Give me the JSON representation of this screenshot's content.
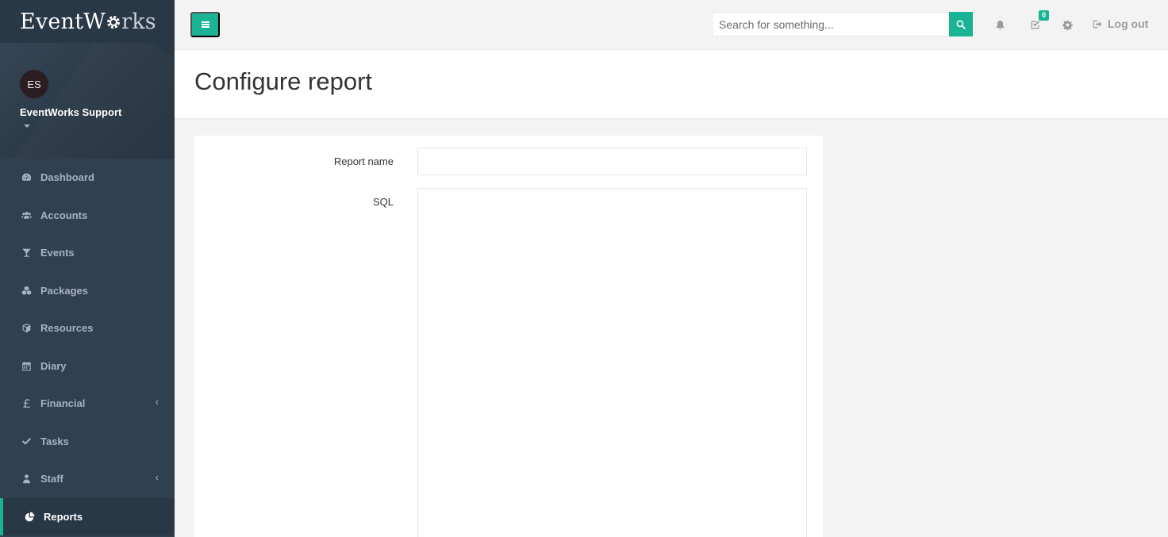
{
  "app": {
    "logo_part1": "EventW",
    "logo_part2": "rks",
    "brand_color": "#1ab394",
    "sidebar_color": "#2f4050"
  },
  "profile": {
    "initials": "ES",
    "name": "EventWorks Support"
  },
  "sidebar": {
    "items": [
      {
        "label": "Dashboard",
        "icon": "dashboard-icon"
      },
      {
        "label": "Accounts",
        "icon": "users-icon"
      },
      {
        "label": "Events",
        "icon": "cocktail-icon"
      },
      {
        "label": "Packages",
        "icon": "cubes-icon"
      },
      {
        "label": "Resources",
        "icon": "cube-icon"
      },
      {
        "label": "Diary",
        "icon": "calendar-icon"
      },
      {
        "label": "Financial",
        "icon": "pound-icon",
        "arrow": "‹"
      },
      {
        "label": "Tasks",
        "icon": "check-icon"
      },
      {
        "label": "Staff",
        "icon": "user-icon",
        "arrow": "‹"
      },
      {
        "label": "Reports",
        "icon": "pie-chart-icon",
        "active": true
      }
    ]
  },
  "topbar": {
    "search_placeholder": "Search for something...",
    "tasks_badge": "0",
    "logout_label": "Log out"
  },
  "page": {
    "title": "Configure report"
  },
  "form": {
    "report_name_label": "Report name",
    "report_name_value": "",
    "sql_label": "SQL",
    "sql_value": ""
  }
}
